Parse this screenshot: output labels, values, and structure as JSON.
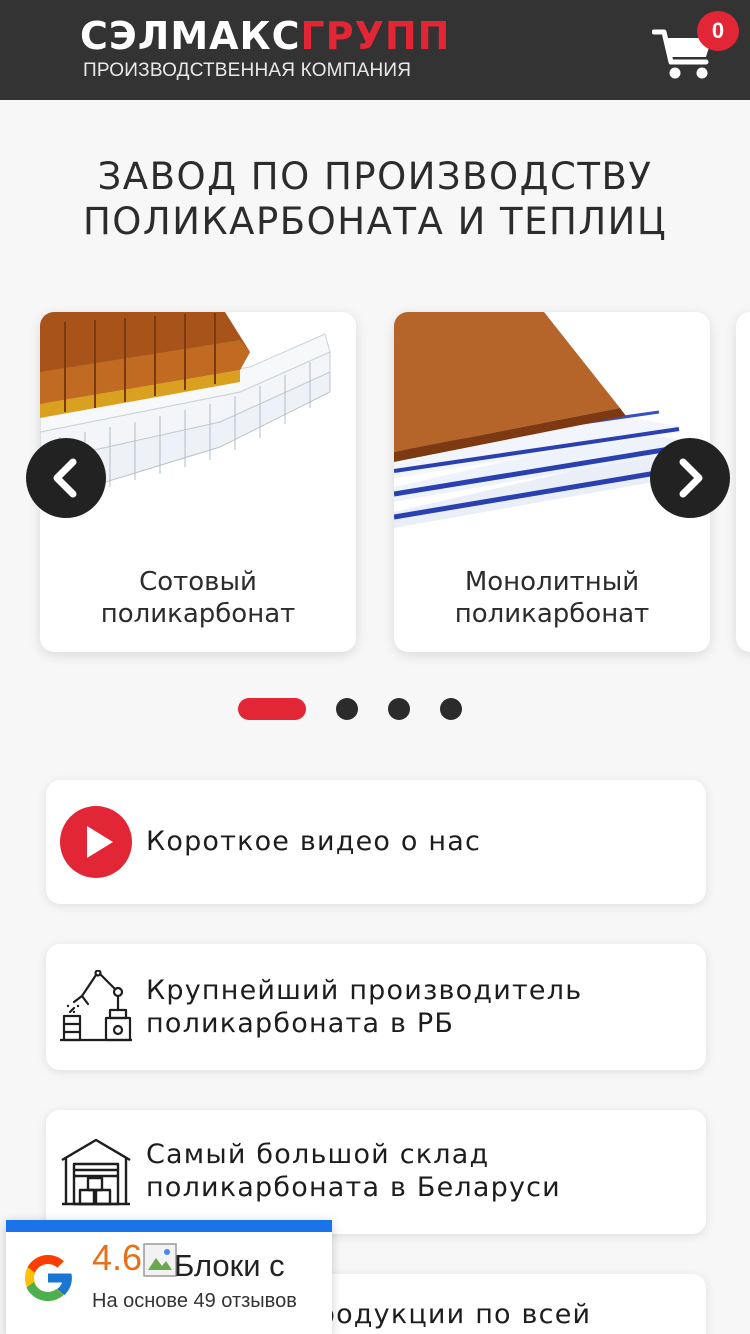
{
  "header": {
    "logo_part1": "СЭЛМАКС",
    "logo_part2": "ГРУПП",
    "logo_subtitle": "ПРОИЗВОДСТВЕННАЯ КОМПАНИЯ",
    "cart_icon": "shopping-cart-icon",
    "cart_count": "0"
  },
  "hero": {
    "title_line1": "ЗАВОД ПО ПРОИЗВОДСТВУ",
    "title_line2": "ПОЛИКАРБОНАТА И ТЕПЛИЦ"
  },
  "carousel": {
    "cards": [
      {
        "title_line1": "Сотовый",
        "title_line2": "поликарбонат"
      },
      {
        "title_line1": "Монолитный",
        "title_line2": "поликарбонат"
      }
    ],
    "prev_icon": "chevron-left-icon",
    "next_icon": "chevron-right-icon",
    "dots_total": 4,
    "active_dot": 1
  },
  "features": [
    {
      "icon": "play-icon",
      "line1": "Короткое видео о нас"
    },
    {
      "icon": "factory-robot-icon",
      "line1": "Крупнейший производитель",
      "line2": "поликарбоната в РБ"
    },
    {
      "icon": "warehouse-icon",
      "line1": "Самый большой склад",
      "line2": "поликарбоната в Беларуси"
    },
    {
      "icon": "delivery-icon",
      "line1": "Доставка продукции по всей"
    }
  ],
  "google_widget": {
    "logo_icon": "google-logo-icon",
    "rating": "4.6",
    "broken_image_alt": "Блоки с",
    "subtitle": "На основе 49 отзывов"
  },
  "colors": {
    "header_bg": "#333333",
    "accent_red": "#e32636",
    "google_blue": "#1a73e8",
    "rating_orange": "#e7711b"
  }
}
